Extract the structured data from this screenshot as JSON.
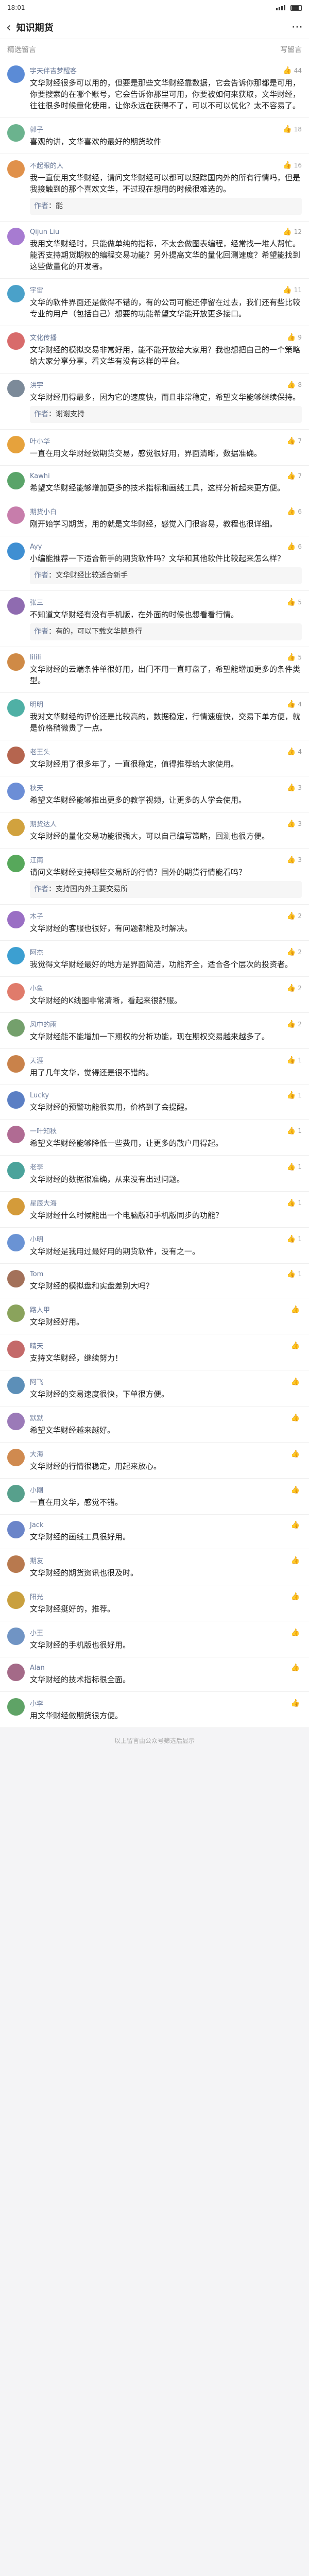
{
  "status": {
    "time": "18:01",
    "battery": ""
  },
  "header": {
    "title": "知识期货"
  },
  "section": {
    "title": "精选留言",
    "right": "写留言"
  },
  "comments": [
    {
      "nick": "宇天伴吉梦醒客",
      "likes": "44",
      "color": "#5b8bd6",
      "text": "文华财经很多可以用的，但要是那些文华财经靠数据，它会告诉你那都是可用，你要搜索的在哪个账号，它会告诉你那里可用，你要被如何来获取，文华财经，往往很多时候量化使用，让你永远在获得不了，可以不可以优化？太不容易了。"
    },
    {
      "nick": "郭子",
      "likes": "18",
      "color": "#6bb38e",
      "text": "喜观的讲，文华喜欢的最好的期货软件"
    },
    {
      "nick": "不起眼的人",
      "likes": "16",
      "color": "#e0914b",
      "text": "我一直使用文华财经，请问文华财经可以都可以跟踪国内外的所有行情吗，但是我接触到的那个喜欢文华，不过现在想用的时候很难选的。",
      "author": "作者",
      "reply": "能",
      "replyName": "作者"
    },
    {
      "nick": "Qijun Liu",
      "likes": "12",
      "color": "#a77bd1",
      "text": "我用文华财经时，只能做单纯的指标，不太会做图表编程，经常找一堆人帮忙。能否支持期货期权的编程交易功能？另外提高文华的量化回测速度？希望能找到这些做量化的开发者。"
    },
    {
      "nick": "宇宙",
      "likes": "11",
      "color": "#4aa1c9",
      "text": "文华的软件界面还是做得不错的，有的公司可能还停留在过去，我们还有些比较专业的用户（包括自己）想要的功能希望文华能开放更多接口。"
    },
    {
      "nick": "文化传播",
      "likes": "9",
      "color": "#d86b6b",
      "text": "文华财经的模拟交易非常好用，能不能开放给大家用？我也想把自己的一个策略给大家分享分享，看文华有没有这样的平台。"
    },
    {
      "nick": "洪宇",
      "likes": "8",
      "color": "#7c8a99",
      "text": "文华财经用得最多，因为它的速度快，而且非常稳定，希望文华能够继续保持。",
      "author": "作者",
      "reply": "谢谢支持",
      "replyName": "作者"
    },
    {
      "nick": "叶小华",
      "likes": "7",
      "color": "#e6a23c",
      "text": "一直在用文华财经做期货交易，感觉很好用，界面清晰，数据准确。"
    },
    {
      "nick": "Kawhi",
      "likes": "7",
      "color": "#5aa469",
      "text": "希望文华财经能够增加更多的技术指标和画线工具，这样分析起来更方便。"
    },
    {
      "nick": "期货小白",
      "likes": "6",
      "color": "#c77dab",
      "text": "刚开始学习期货，用的就是文华财经，感觉入门很容易，教程也很详细。"
    },
    {
      "nick": "Ayy",
      "likes": "6",
      "color": "#3f8fd2",
      "text": "小编能推荐一下适合新手的期货软件吗？文华和其他软件比较起来怎么样？",
      "author": "作者",
      "reply": "文华财经比较适合新手",
      "replyName": "作者"
    },
    {
      "nick": "张三",
      "likes": "5",
      "color": "#8f6bb0",
      "text": "不知道文华财经有没有手机版，在外面的时候也想看看行情。",
      "author": "作者",
      "reply": "有的，可以下载文华随身行",
      "replyName": "作者"
    },
    {
      "nick": "lilili",
      "likes": "5",
      "color": "#cf8a46",
      "text": "文华财经的云端条件单很好用，出门不用一直盯盘了，希望能增加更多的条件类型。"
    },
    {
      "nick": "明明",
      "likes": "4",
      "color": "#4fb0a5",
      "text": "我对文华财经的评价还是比较高的，数据稳定，行情速度快，交易下单方便，就是价格稍微贵了一点。"
    },
    {
      "nick": "老王头",
      "likes": "4",
      "color": "#b5654f",
      "text": "文华财经用了很多年了，一直很稳定，值得推荐给大家使用。"
    },
    {
      "nick": "秋天",
      "likes": "3",
      "color": "#6c8ed6",
      "text": "希望文华财经能够推出更多的教学视频，让更多的人学会使用。"
    },
    {
      "nick": "期货达人",
      "likes": "3",
      "color": "#d1a23e",
      "text": "文华财经的量化交易功能很强大，可以自己编写策略，回测也很方便。"
    },
    {
      "nick": "江南",
      "likes": "3",
      "color": "#57a85b",
      "text": "请问文华财经支持哪些交易所的行情？国外的期货行情能看吗？",
      "author": "作者",
      "reply": "支持国内外主要交易所",
      "replyName": "作者"
    },
    {
      "nick": "木子",
      "likes": "2",
      "color": "#9a6fc4",
      "text": "文华财经的客服也很好，有问题都能及时解决。"
    },
    {
      "nick": "阿杰",
      "likes": "2",
      "color": "#3c9fd1",
      "text": "我觉得文华财经最好的地方是界面简洁，功能齐全，适合各个层次的投资者。"
    },
    {
      "nick": "小鱼",
      "likes": "2",
      "color": "#e07b6b",
      "text": "文华财经的K线图非常清晰，看起来很舒服。"
    },
    {
      "nick": "风中的雨",
      "likes": "2",
      "color": "#74a06c",
      "text": "文华财经能不能增加一下期权的分析功能，现在期权交易越来越多了。"
    },
    {
      "nick": "天涯",
      "likes": "1",
      "color": "#c9824a",
      "text": "用了几年文华，觉得还是很不错的。"
    },
    {
      "nick": "Lucky",
      "likes": "1",
      "color": "#5b7fc4",
      "text": "文华财经的预警功能很实用，价格到了会提醒。"
    },
    {
      "nick": "一叶知秋",
      "likes": "1",
      "color": "#b06b93",
      "text": "希望文华财经能够降低一些费用，让更多的散户用得起。"
    },
    {
      "nick": "老李",
      "likes": "1",
      "color": "#4ba39b",
      "text": "文华财经的数据很准确，从来没有出过问题。"
    },
    {
      "nick": "星辰大海",
      "likes": "1",
      "color": "#d49b3a",
      "text": "文华财经什么时候能出一个电脑版和手机版同步的功能？"
    },
    {
      "nick": "小明",
      "likes": "1",
      "color": "#6a93d4",
      "text": "文华财经是我用过最好用的期货软件，没有之一。"
    },
    {
      "nick": "Tom",
      "likes": "1",
      "color": "#a3715a",
      "text": "文华财经的模拟盘和实盘差别大吗？"
    },
    {
      "nick": "路人甲",
      "likes": "",
      "color": "#8aa35c",
      "text": "文华财经好用。"
    },
    {
      "nick": "晴天",
      "likes": "",
      "color": "#c46a6a",
      "text": "支持文华财经，继续努力！"
    },
    {
      "nick": "阿飞",
      "likes": "",
      "color": "#5c8fb8",
      "text": "文华财经的交易速度很快，下单很方便。"
    },
    {
      "nick": "默默",
      "likes": "",
      "color": "#9b7ab8",
      "text": "希望文华财经越来越好。"
    },
    {
      "nick": "大海",
      "likes": "",
      "color": "#d08a4f",
      "text": "文华财经的行情很稳定，用起来放心。"
    },
    {
      "nick": "小刚",
      "likes": "",
      "color": "#57a08c",
      "text": "一直在用文华，感觉不错。"
    },
    {
      "nick": "Jack",
      "likes": "",
      "color": "#6b85c9",
      "text": "文华财经的画线工具很好用。"
    },
    {
      "nick": "期友",
      "likes": "",
      "color": "#b8794e",
      "text": "文华财经的期货资讯也很及时。"
    },
    {
      "nick": "阳光",
      "likes": "",
      "color": "#c9a03f",
      "text": "文华财经挺好的，推荐。"
    },
    {
      "nick": "小王",
      "likes": "",
      "color": "#7094c4",
      "text": "文华财经的手机版也很好用。"
    },
    {
      "nick": "Alan",
      "likes": "",
      "color": "#a46a88",
      "text": "文华财经的技术指标很全面。"
    },
    {
      "nick": "小李",
      "likes": "",
      "color": "#5fa366",
      "text": "用文华财经做期货很方便。"
    }
  ],
  "footer": {
    "text": "以上留言由公众号筛选后显示"
  }
}
